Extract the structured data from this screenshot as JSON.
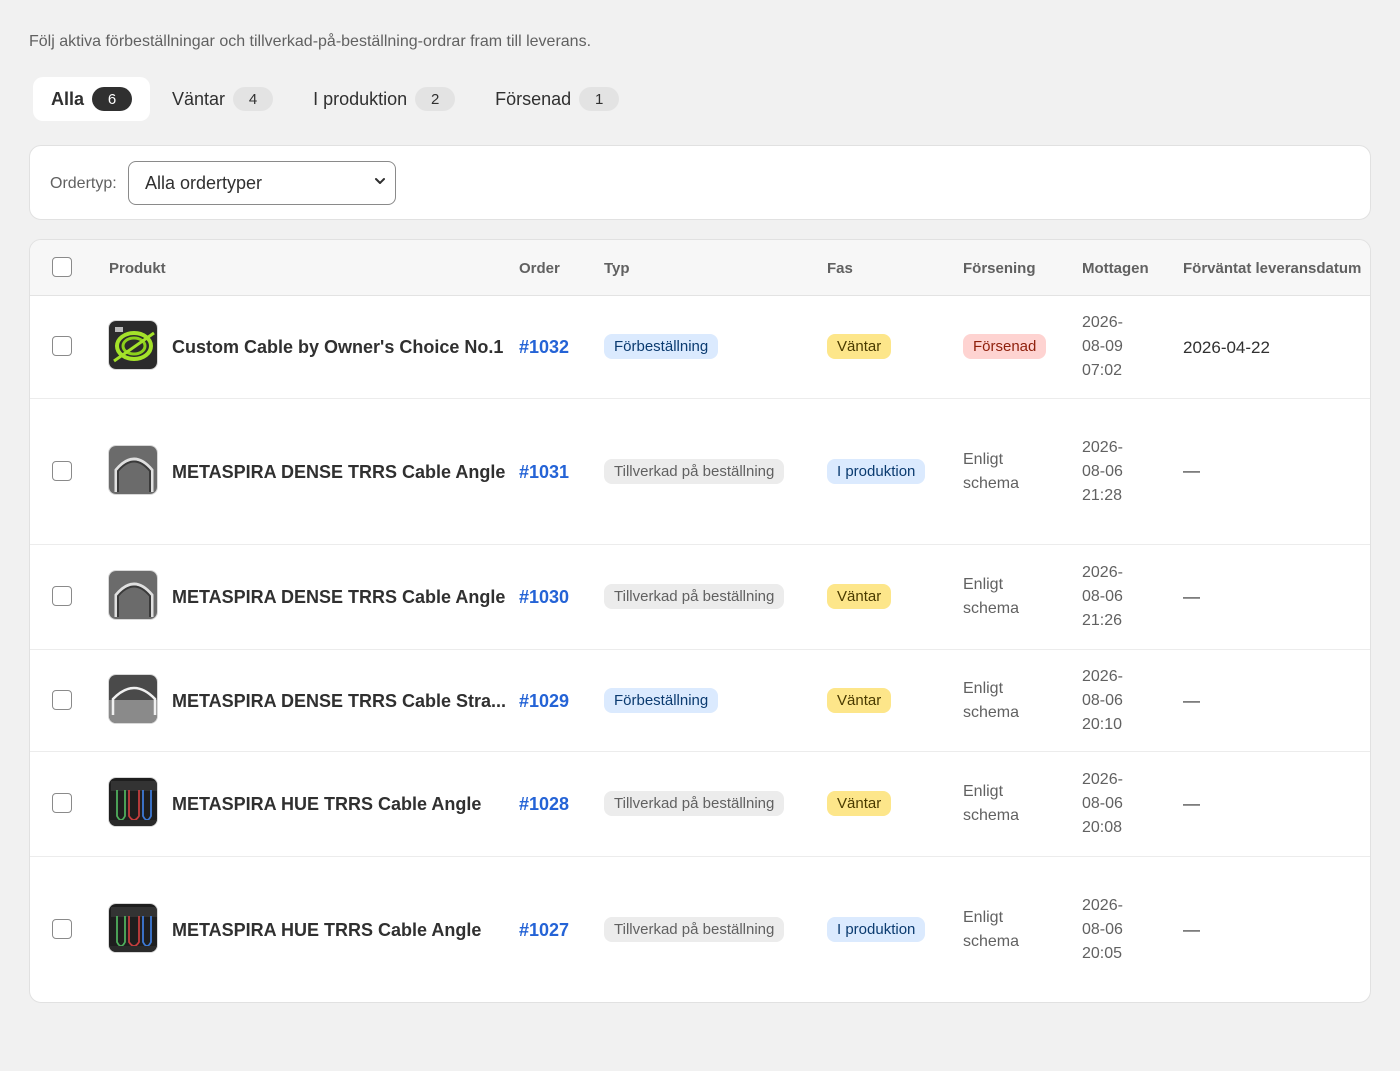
{
  "subtitle": "Följ aktiva förbeställningar och tillverkad-på-beställning-ordrar fram till leverans.",
  "tabs": [
    {
      "label": "Alla",
      "count": "6"
    },
    {
      "label": "Väntar",
      "count": "4"
    },
    {
      "label": "I produktion",
      "count": "2"
    },
    {
      "label": "Försenad",
      "count": "1"
    }
  ],
  "filter": {
    "label": "Ordertyp:",
    "value": "Alla ordertyper"
  },
  "columns": {
    "product": "Produkt",
    "order": "Order",
    "type": "Typ",
    "phase": "Fas",
    "delay": "Försening",
    "received": "Mottagen",
    "expected": "Förväntat leveransdatum"
  },
  "colors": {
    "link": "#2463d6",
    "blue_badge": "#dbeafe",
    "yellow_badge": "#fde68a",
    "red_badge": "#fed3d1",
    "grey_badge": "#ececec"
  },
  "rows": [
    {
      "product": "Custom Cable by Owner's Choice No.1",
      "thumb": "green-coiled-cable",
      "order": "#1032",
      "type": "Förbeställning",
      "type_style": "blue",
      "phase": "Väntar",
      "phase_style": "yellow",
      "delay": "Försenad",
      "delay_style": "red",
      "received": [
        "2026-",
        "08-09",
        "07:02"
      ],
      "expected": "2026-04-22"
    },
    {
      "product": "METASPIRA DENSE TRRS Cable Angle",
      "thumb": "grey-arched-cable",
      "order": "#1031",
      "type": "Tillverkad på beställning",
      "type_style": "grey",
      "phase": "I produktion",
      "phase_style": "blue",
      "delay": [
        "Enligt",
        "schema"
      ],
      "received": [
        "2026-",
        "08-06",
        "21:28"
      ],
      "expected": "—"
    },
    {
      "product": "METASPIRA DENSE TRRS Cable Angle",
      "thumb": "grey-arched-cable",
      "order": "#1030",
      "type": "Tillverkad på beställning",
      "type_style": "grey",
      "phase": "Väntar",
      "phase_style": "yellow",
      "delay": [
        "Enligt",
        "schema"
      ],
      "received": [
        "2026-",
        "08-06",
        "21:26"
      ],
      "expected": "—"
    },
    {
      "product": "METASPIRA DENSE TRRS Cable Stra...",
      "thumb": "dark-arched-cable",
      "order": "#1029",
      "type": "Förbeställning",
      "type_style": "blue",
      "phase": "Väntar",
      "phase_style": "yellow",
      "delay": [
        "Enligt",
        "schema"
      ],
      "received": [
        "2026-",
        "08-06",
        "20:10"
      ],
      "expected": "—"
    },
    {
      "product": "METASPIRA HUE TRRS Cable Angle",
      "thumb": "colored-cables",
      "order": "#1028",
      "type": "Tillverkad på beställning",
      "type_style": "grey",
      "phase": "Väntar",
      "phase_style": "yellow",
      "delay": [
        "Enligt",
        "schema"
      ],
      "received": [
        "2026-",
        "08-06",
        "20:08"
      ],
      "expected": "—"
    },
    {
      "product": "METASPIRA HUE TRRS Cable Angle",
      "thumb": "colored-cables",
      "order": "#1027",
      "type": "Tillverkad på beställning",
      "type_style": "grey",
      "phase": "I produktion",
      "phase_style": "blue",
      "delay": [
        "Enligt",
        "schema"
      ],
      "received": [
        "2026-",
        "08-06",
        "20:05"
      ],
      "expected": "—"
    }
  ]
}
